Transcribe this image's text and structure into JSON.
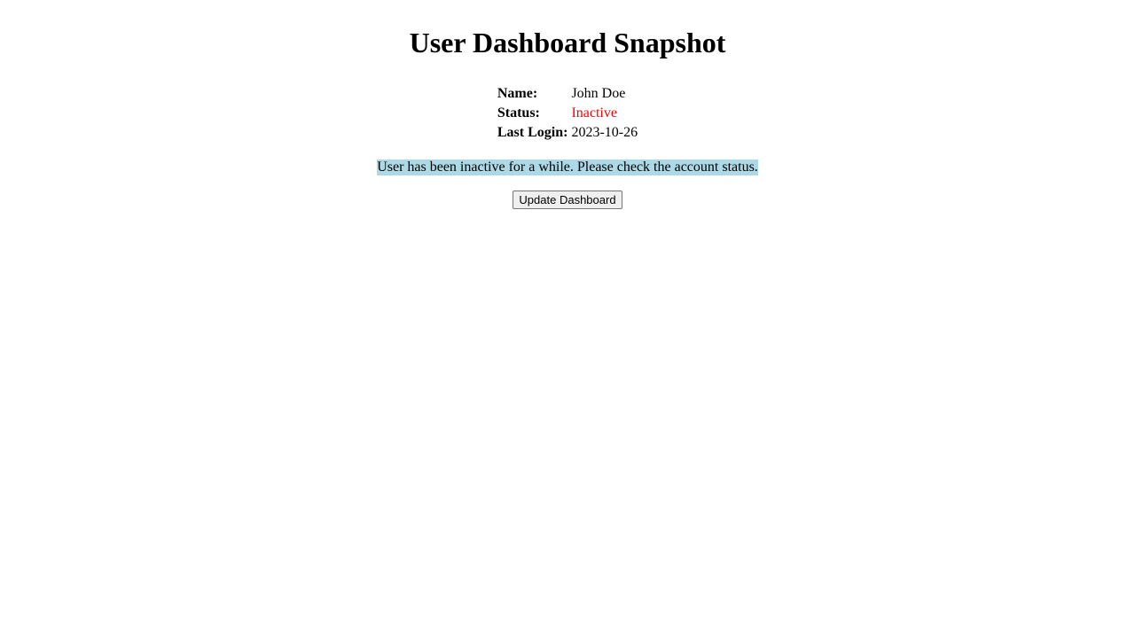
{
  "page": {
    "title": "User Dashboard Snapshot"
  },
  "user_info": {
    "rows": [
      {
        "label": "Name:",
        "value": "John Doe"
      },
      {
        "label": "Status:",
        "value": "Inactive"
      },
      {
        "label": "Last Login:",
        "value": "2023-10-26"
      }
    ],
    "status_color": "#ff0000"
  },
  "notice": {
    "text": "User has been inactive for a while. Please check the account status.",
    "background_color": "#add8e6"
  },
  "actions": {
    "update_label": "Update Dashboard"
  }
}
